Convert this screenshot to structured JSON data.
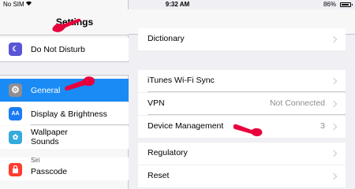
{
  "status_bar": {
    "carrier": "No SIM",
    "wifi_icon": "wifi-icon",
    "time": "9:32 AM",
    "battery": "86%"
  },
  "sidebar": {
    "title": "Settings",
    "items": [
      {
        "label": "Do Not Disturb",
        "icon": "moon-icon",
        "color": "#5856d6",
        "glyph": "☾"
      },
      {
        "label": "General",
        "icon": "gear-icon",
        "color": "#8e8e93",
        "glyph": "⚙",
        "selected": true
      },
      {
        "label": "Display & Brightness",
        "icon": "text-size-icon",
        "color": "#1a7cf4",
        "glyph": "AA"
      },
      {
        "label": "Wallpaper",
        "icon": "wallpaper-icon",
        "color": "#35aadc",
        "glyph": "✿"
      },
      {
        "label": "Sounds",
        "icon": "sound-icon",
        "color": "#ff2d55",
        "glyph": ""
      },
      {
        "label": "Siri",
        "icon": "siri-icon",
        "color": "#222222",
        "glyph": ""
      },
      {
        "label": "Passcode",
        "icon": "lock-icon",
        "color": "#ff3b30",
        "glyph": "■"
      }
    ]
  },
  "main": {
    "items": [
      {
        "label": "Dictionary",
        "value": ""
      },
      {
        "label": "iTunes Wi-Fi Sync",
        "value": ""
      },
      {
        "label": "VPN",
        "value": "Not Connected"
      },
      {
        "label": "Device Management",
        "value": "3"
      },
      {
        "label": "Regulatory",
        "value": ""
      },
      {
        "label": "Reset",
        "value": ""
      }
    ]
  },
  "colors": {
    "accent": "#1a8bf4",
    "annotation": "#e8003d"
  }
}
